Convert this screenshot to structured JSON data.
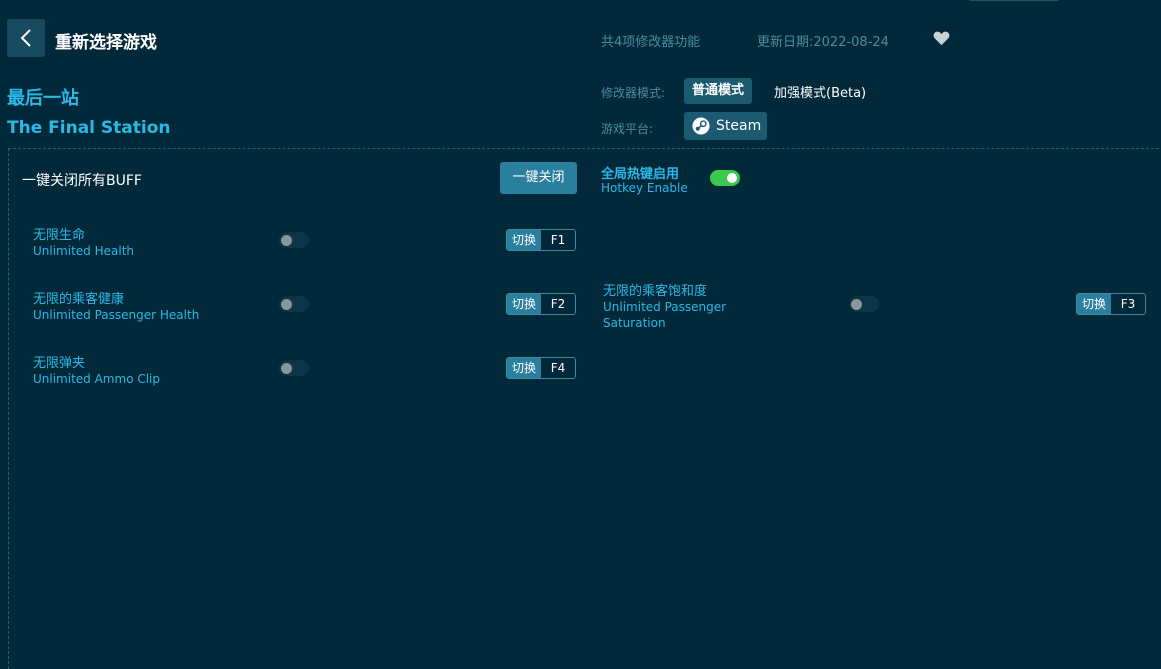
{
  "header": {
    "back_label": "重新选择游戏",
    "feature_count": "共4项修改器功能",
    "update_date": "更新日期:2022-08-24"
  },
  "game": {
    "name_cn": "最后一站",
    "name_en": "The Final Station"
  },
  "mode": {
    "label": "修改器模式:",
    "normal": "普通模式",
    "enhanced": "加强模式(Beta)",
    "active": "普通模式"
  },
  "platform": {
    "label": "游戏平台:",
    "name": "Steam"
  },
  "buff": {
    "title": "一键关闭所有BUFF",
    "close_all": "一键关闭"
  },
  "hotkey": {
    "label_cn": "全局热键启用",
    "label_en": "Hotkey Enable",
    "enabled": true
  },
  "features": [
    {
      "name_cn": "无限生命",
      "name_en": "Unlimited Health",
      "switch_label": "切换",
      "key": "F1",
      "enabled": false
    },
    {
      "name_cn": "无限的乘客健康",
      "name_en": "Unlimited Passenger Health",
      "switch_label": "切换",
      "key": "F2",
      "enabled": false
    },
    {
      "name_cn": "无限的乘客饱和度",
      "name_en_line1": "Unlimited Passenger",
      "name_en_line2": "Saturation",
      "switch_label": "切换",
      "key": "F3",
      "enabled": false
    },
    {
      "name_cn": "无限弹夹",
      "name_en": "Unlimited Ammo Clip",
      "switch_label": "切换",
      "key": "F4",
      "enabled": false
    }
  ],
  "colors": {
    "background": "#02293a",
    "accent": "#2bb8e6",
    "button": "#2a7f9e",
    "toggle_on": "#3bc84b"
  }
}
